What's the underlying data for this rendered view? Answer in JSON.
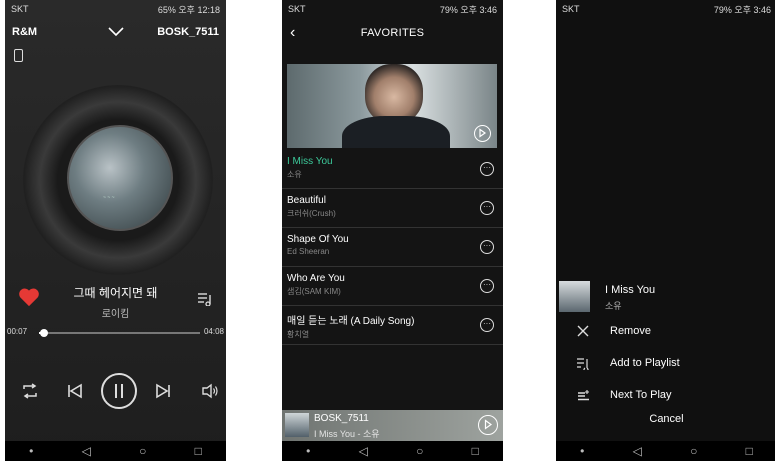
{
  "colors": {
    "accent_green": "#3cc99a",
    "heart_red": "#e53935"
  },
  "player": {
    "status": {
      "carrier": "SKT",
      "right": "65% 오후 12:18"
    },
    "header": {
      "left_label": "R&M",
      "device_name": "BOSK_7511"
    },
    "song_title": "그때 헤어지면 돼",
    "artist": "로이킴",
    "elapsed": "00:07",
    "duration": "04:08",
    "progress_fraction": 0.03
  },
  "favorites": {
    "status": {
      "carrier": "SKT",
      "right": "79% 오후 3:46"
    },
    "title": "FAVORITES",
    "songs": [
      {
        "title": "I Miss You",
        "artist": "소유",
        "active": true
      },
      {
        "title": "Beautiful",
        "artist": "크러쉬(Crush)",
        "active": false
      },
      {
        "title": "Shape Of You",
        "artist": "Ed Sheeran",
        "active": false
      },
      {
        "title": "Who Are You",
        "artist": "샘김(SAM KIM)",
        "active": false
      },
      {
        "title": "매일 듣는 노래 (A Daily Song)",
        "artist": "황치열",
        "active": false
      }
    ],
    "mini_player": {
      "device": "BOSK_7511",
      "now_playing": "I Miss You - 소유"
    }
  },
  "sheet": {
    "status": {
      "carrier": "SKT",
      "right": "79% 오후 3:46"
    },
    "song_title": "I Miss You",
    "artist": "소유",
    "actions": [
      {
        "label": "Remove",
        "icon": "close-icon"
      },
      {
        "label": "Add to Playlist",
        "icon": "add-to-playlist-icon"
      },
      {
        "label": "Next To Play",
        "icon": "next-to-play-icon"
      }
    ],
    "cancel_label": "Cancel"
  }
}
